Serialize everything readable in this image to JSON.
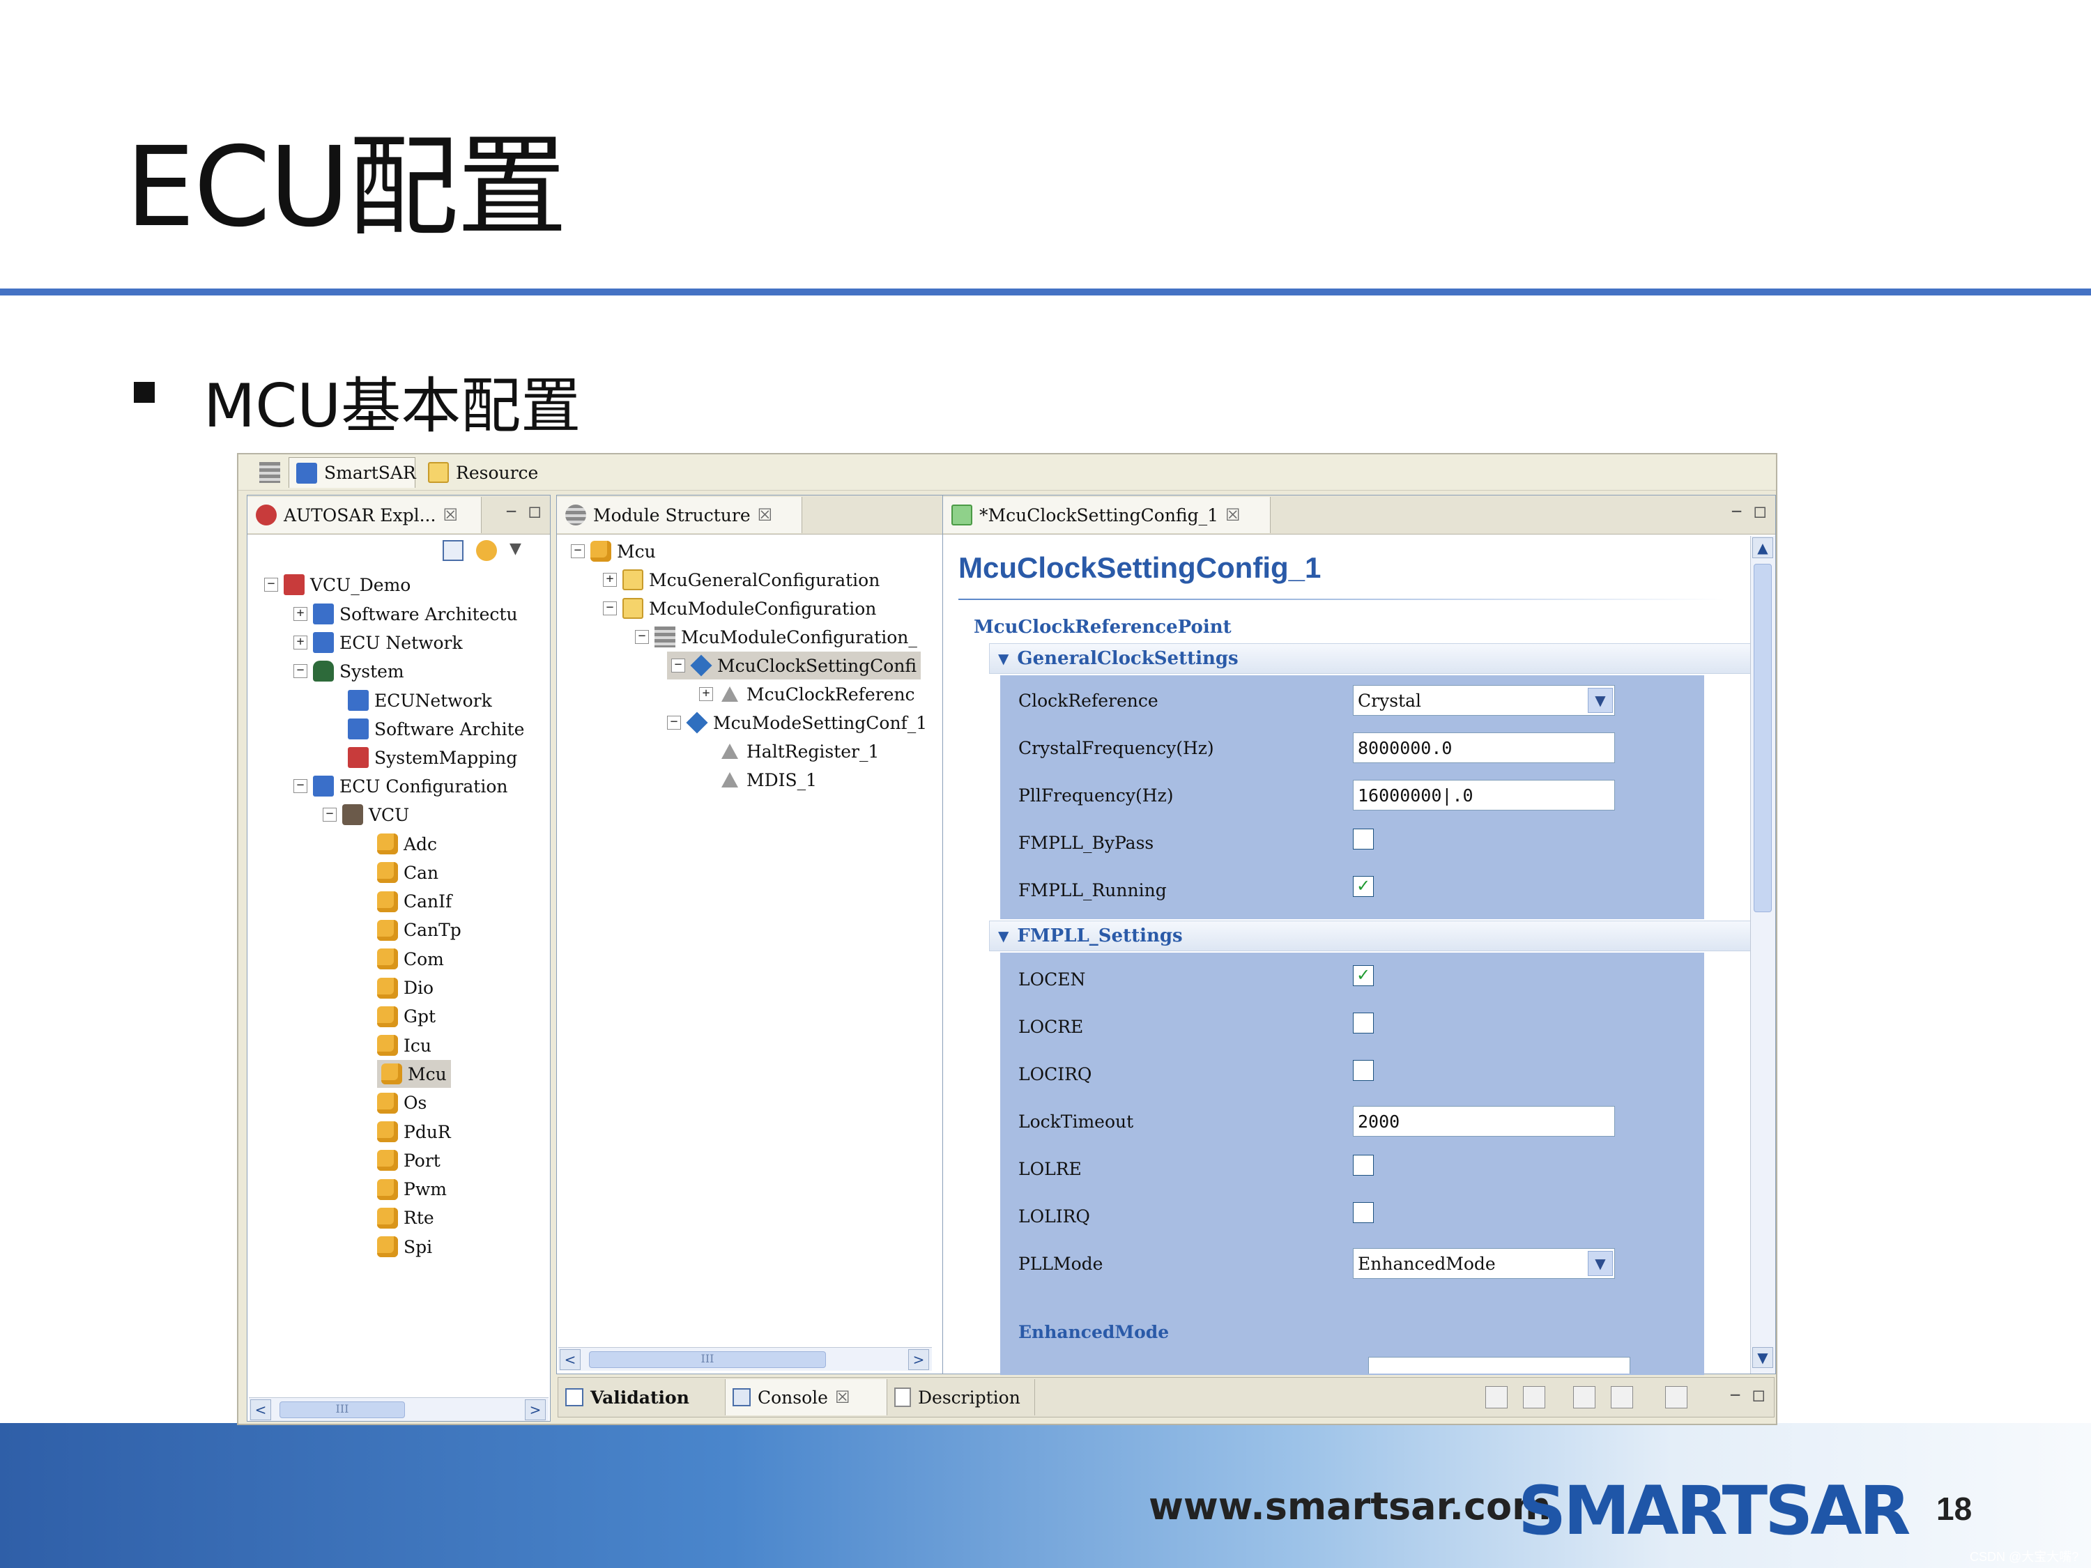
{
  "slide": {
    "title": "ECU配置",
    "bullet": "MCU基本配置",
    "footer_url": "www.smartsar.com",
    "footer_logo": "SMARTSAR",
    "page_number": "18",
    "watermark": "CSDN @大宝大嘴?"
  },
  "colors": {
    "accent": "#4472c4",
    "form_title": "#2a5aa8",
    "section_fill": "#a8bde2"
  },
  "perspectives": [
    "SmartSAR",
    "Resource"
  ],
  "explorer": {
    "tab": "AUTOSAR Expl...",
    "tree": [
      "VCU_Demo",
      "Software Architectu",
      "ECU Network",
      "System",
      "ECUNetwork",
      "Software Archite",
      "SystemMapping",
      "ECU Configuration",
      "VCU",
      "Adc",
      "Can",
      "CanIf",
      "CanTp",
      "Com",
      "Dio",
      "Gpt",
      "Icu",
      "Mcu",
      "Os",
      "PduR",
      "Port",
      "Pwm",
      "Rte",
      "Spi"
    ],
    "scroll_thumb": "III"
  },
  "module": {
    "tab": "Module Structure",
    "tree": [
      "Mcu",
      "McuGeneralConfiguration",
      "McuModuleConfiguration",
      "McuModuleConfiguration_",
      "McuClockSettingConfi",
      "McuClockReferenc",
      "McuModeSettingConf_1",
      "HaltRegister_1",
      "MDIS_1"
    ],
    "scroll_thumb": "III"
  },
  "editor": {
    "tab": "*McuClockSettingConfig_1",
    "form_title": "McuClockSettingConfig_1",
    "ref_point": "McuClockReferencePoint",
    "sections": [
      "GeneralClockSettings",
      "FMPLL_Settings"
    ],
    "general": {
      "clock_reference_label": "ClockReference",
      "clock_reference_value": "Crystal",
      "crystal_freq_label": "CrystalFrequency(Hz)",
      "crystal_freq_value": "8000000.0",
      "pll_freq_label": "PllFrequency(Hz)",
      "pll_freq_value": "16000000|.0",
      "bypass_label": "FMPLL_ByPass",
      "bypass_checked": false,
      "running_label": "FMPLL_Running",
      "running_checked": true
    },
    "fmpll": {
      "locen_label": "LOCEN",
      "locen_checked": true,
      "locre_label": "LOCRE",
      "locre_checked": false,
      "locirq_label": "LOCIRQ",
      "locirq_checked": false,
      "lock_timeout_label": "LockTimeout",
      "lock_timeout_value": "2000",
      "lolre_label": "LOLRE",
      "lolre_checked": false,
      "lolirq_label": "LOLIRQ",
      "lolirq_checked": false,
      "pll_mode_label": "PLLMode",
      "pll_mode_value": "EnhancedMode",
      "enhanced_mode_label": "EnhancedMode"
    }
  },
  "bottom_tabs": [
    "Validation",
    "Console",
    "Description"
  ],
  "glyphs": {
    "check": "✓",
    "close": "☒",
    "minimize": "−",
    "maximize": "□",
    "dropdown": "▼",
    "left": "<",
    "right": ">",
    "up": "▲",
    "down": "▼",
    "expanded": "−",
    "collapsed": "+",
    "section_arrow": "▼"
  }
}
